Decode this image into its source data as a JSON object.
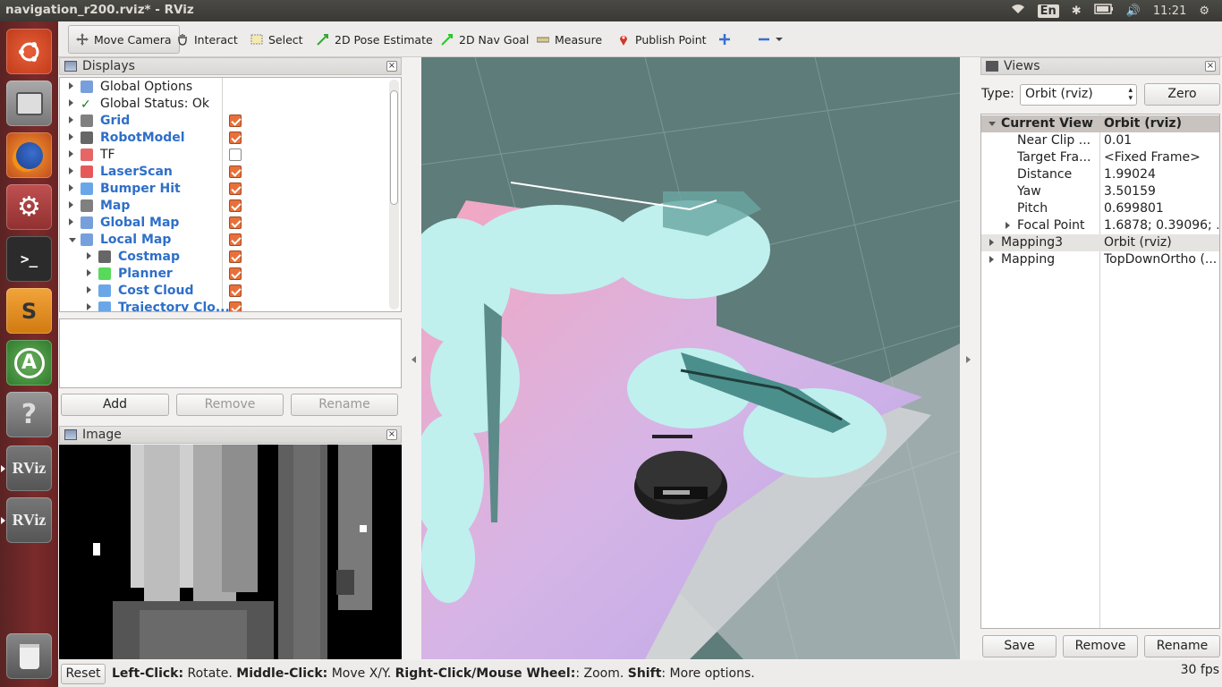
{
  "window": {
    "title": "navigation_r200.rviz* - RViz"
  },
  "tray": {
    "keyboard": "En",
    "clock": "11:21"
  },
  "launcher": {
    "items": [
      {
        "name": "ubuntu-dash-icon",
        "label": ""
      },
      {
        "name": "files-icon",
        "label": ""
      },
      {
        "name": "firefox-icon",
        "label": ""
      },
      {
        "name": "settings-icon",
        "label": ""
      },
      {
        "name": "terminal-icon",
        "label": ""
      },
      {
        "name": "sublime-icon",
        "label": "S"
      },
      {
        "name": "updater-icon",
        "label": "A"
      },
      {
        "name": "help-icon",
        "label": "?"
      },
      {
        "name": "rviz-icon",
        "label": "RViz"
      },
      {
        "name": "rviz-icon",
        "label": "RViz"
      },
      {
        "name": "trash-icon",
        "label": ""
      }
    ]
  },
  "toolbar": {
    "move_camera": "Move Camera",
    "interact": "Interact",
    "select": "Select",
    "pose_estimate": "2D Pose Estimate",
    "nav_goal": "2D Nav Goal",
    "measure": "Measure",
    "publish_point": "Publish Point"
  },
  "displays": {
    "title": "Displays",
    "items": [
      {
        "label": "Global Options",
        "checked": null,
        "blue": false
      },
      {
        "label": "Global Status: Ok",
        "checked": null,
        "blue": false
      },
      {
        "label": "Grid",
        "checked": true,
        "blue": true
      },
      {
        "label": "RobotModel",
        "checked": true,
        "blue": true
      },
      {
        "label": "TF",
        "checked": false,
        "blue": false
      },
      {
        "label": "LaserScan",
        "checked": true,
        "blue": true
      },
      {
        "label": "Bumper Hit",
        "checked": true,
        "blue": true
      },
      {
        "label": "Map",
        "checked": true,
        "blue": true
      },
      {
        "label": "Global Map",
        "checked": true,
        "blue": true
      },
      {
        "label": "Local Map",
        "checked": true,
        "blue": true
      },
      {
        "label": "Costmap",
        "checked": true,
        "blue": true
      },
      {
        "label": "Planner",
        "checked": true,
        "blue": true
      },
      {
        "label": "Cost Cloud",
        "checked": true,
        "blue": true
      },
      {
        "label": "Trajectory Clo...",
        "checked": true,
        "blue": true
      }
    ],
    "add": "Add",
    "remove": "Remove",
    "rename": "Rename"
  },
  "image_panel": {
    "title": "Image"
  },
  "views": {
    "title": "Views",
    "type_label": "Type:",
    "type_value": "Orbit (rviz)",
    "zero": "Zero",
    "rows": [
      {
        "key": "Current View",
        "value": "Orbit (rviz)"
      },
      {
        "key": "Near Clip ...",
        "value": "0.01"
      },
      {
        "key": "Target Fra...",
        "value": "<Fixed Frame>"
      },
      {
        "key": "Distance",
        "value": "1.99024"
      },
      {
        "key": "Yaw",
        "value": "3.50159"
      },
      {
        "key": "Pitch",
        "value": "0.699801"
      },
      {
        "key": "Focal Point",
        "value": "1.6878; 0.39096; ..."
      },
      {
        "key": "Mapping3",
        "value": "Orbit (rviz)"
      },
      {
        "key": "Mapping",
        "value": "TopDownOrtho (..."
      }
    ],
    "save": "Save",
    "remove": "Remove",
    "rename": "Rename"
  },
  "status": {
    "reset": "Reset",
    "left_click": "Left-Click:",
    "left_action": " Rotate. ",
    "middle_click": "Middle-Click:",
    "middle_action": " Move X/Y. ",
    "right_click": "Right-Click/Mouse Wheel:",
    "right_action": ": Zoom. ",
    "shift": "Shift",
    "shift_action": ": More options.",
    "fps": "30 fps"
  },
  "colors": {
    "accent_checkbox": "#e8703a",
    "link_blue": "#2e6fc9",
    "viewport_bg": "#5e7c79"
  }
}
